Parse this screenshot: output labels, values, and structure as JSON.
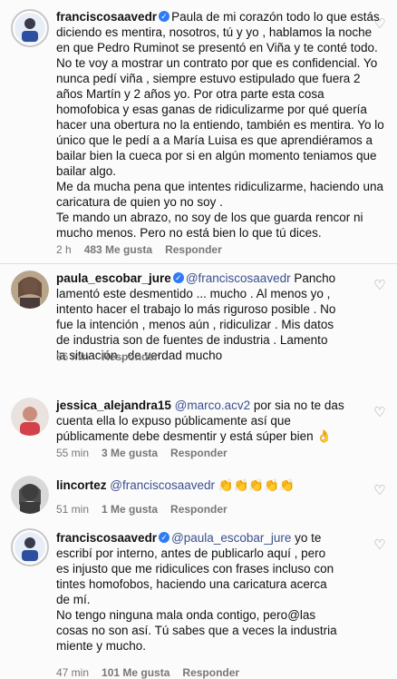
{
  "comments": [
    {
      "user": "franciscosaavedr",
      "verified": true,
      "mention": "",
      "lines": [
        "Paula de mi corazón todo lo que estás",
        "diciendo es mentira, nosotros, tú y yo , hablamos la noche",
        "en que Pedro Ruminot se presentó en Viña y te conté todo.",
        "No te voy a mostrar un contrato por que es confidencial. Yo",
        "nunca pedí viña , siempre estuvo estipulado que fuera 2",
        "años Martín y 2 años yo. Por otra parte esta cosa",
        "homofobica y esas ganas de ridiculizarme por qué quería",
        "hacer una obertura no la entiendo, también es mentira. Yo lo",
        "único que le pedí a a María Luisa es que aprendiéramos a",
        "bailar bien la cueca por si en algún momento teniamos que",
        "bailar algo.",
        "Me da mucha pena que intentes ridiculizarme, haciendo una",
        "caricatura de quien yo no soy .",
        "Te mando un abrazo, no soy de los que guarda rencor ni",
        "mucho menos. Pero no está bien lo que tú dices."
      ],
      "time": "2 h",
      "likes": "483 Me gusta",
      "reply": "Responder"
    },
    {
      "user": "paula_escobar_jure",
      "verified": true,
      "mention": "@franciscosaavedr",
      "lines": [
        "Pancho",
        "lamentó este desmentido ... mucho . Al menos yo ,",
        "intento hacer el trabajo lo más riguroso posible . No",
        "fue la intención , menos aún , ridiculizar . Mis datos",
        "de industria son de fuentes de industria . Lamento",
        "la situación , de verdad mucho"
      ],
      "time": "56 min",
      "likes": "",
      "reply": "Responder"
    },
    {
      "user": "jessica_alejandra15",
      "verified": false,
      "mention": "@marco.acv2",
      "lines": [
        "por sia no te das",
        "cuenta ella lo expuso públicamente así que",
        "públicamente debe desmentir y está súper bien 👌"
      ],
      "time": "55 min",
      "likes": "3 Me gusta",
      "reply": "Responder"
    },
    {
      "user": "lincortez",
      "verified": false,
      "mention": "@franciscosaavedr",
      "lines": [
        "👏👏👏👏👏"
      ],
      "time": "51 min",
      "likes": "1 Me gusta",
      "reply": "Responder"
    },
    {
      "user": "franciscosaavedr",
      "verified": true,
      "mention": "@paula_escobar_jure",
      "lines": [
        "yo te",
        "escribí por interno, antes de publicarlo aquí , pero",
        "es injusto que me ridiculices con frases incluso con",
        "tintes homofobos, haciendo una caricatura acerca",
        "de mí.",
        "No tengo ninguna mala onda contigo, pero@las",
        "cosas no son así. Tú sabes que a veces la industria",
        "miente y mucho."
      ],
      "time": "47 min",
      "likes": "101 Me gusta",
      "reply": "Responder"
    }
  ]
}
